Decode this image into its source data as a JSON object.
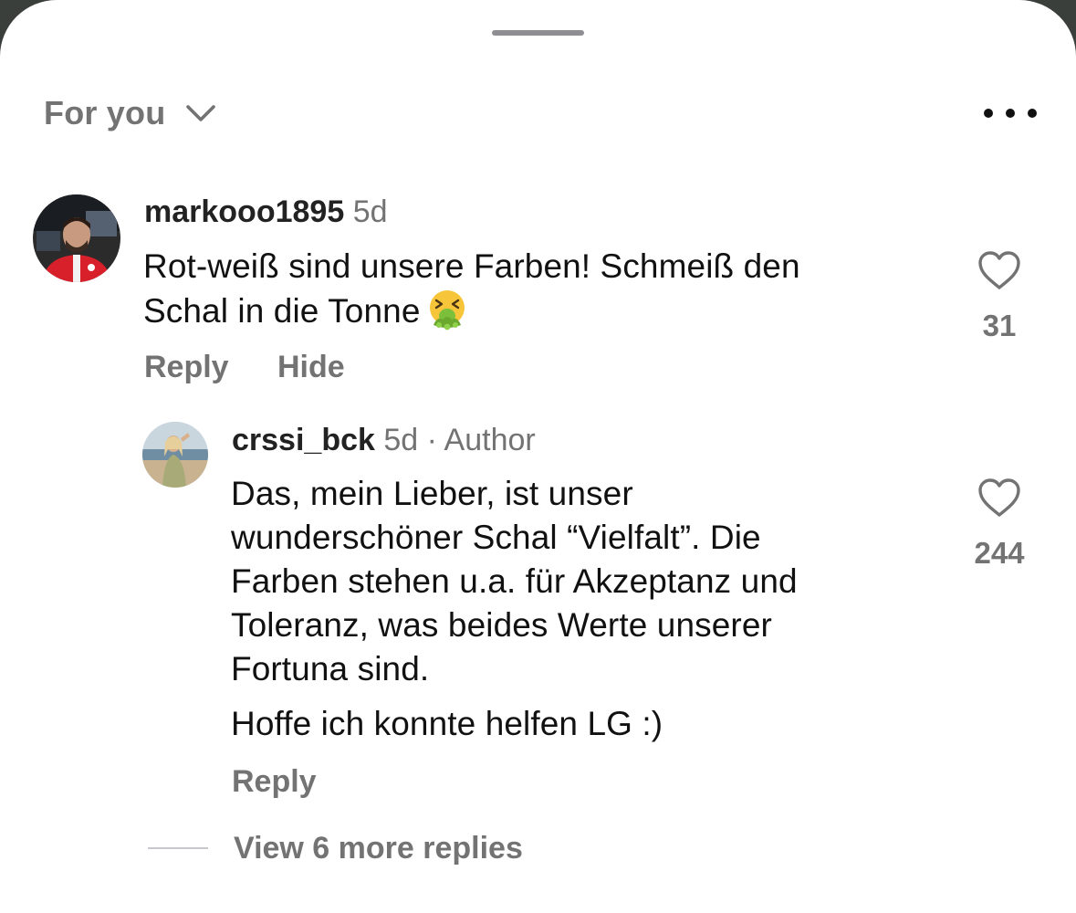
{
  "header": {
    "feed_label": "For you",
    "chevron_icon": "chevron-down-icon",
    "more_icon": "more-horizontal-icon"
  },
  "comments": [
    {
      "username": "markooo1895",
      "time": "5d",
      "text_line1": "Rot-weiß sind unsere Farben! Schmeiß den",
      "text_line2": "Schal in die Tonne",
      "emoji": "🤮",
      "emoji_icon": "vomiting-face-icon",
      "reply_label": "Reply",
      "hide_label": "Hide",
      "like_count": "31"
    }
  ],
  "replies": [
    {
      "username": "crssi_bck",
      "time": "5d",
      "separator": "·",
      "badge": "Author",
      "paragraph1": [
        "Das, mein Lieber, ist unser",
        "wunderschöner Schal “Vielfalt”. Die",
        "Farben stehen u.a. für Akzeptanz und",
        "Toleranz, was beides Werte unserer",
        "Fortuna sind."
      ],
      "paragraph2": "Hoffe ich konnte helfen LG :)",
      "reply_label": "Reply",
      "like_count": "244"
    }
  ],
  "thread": {
    "view_more_label": "View 6 more replies"
  },
  "colors": {
    "secondary_text": "#737373",
    "primary_text": "#111111",
    "background": "#ffffff"
  }
}
